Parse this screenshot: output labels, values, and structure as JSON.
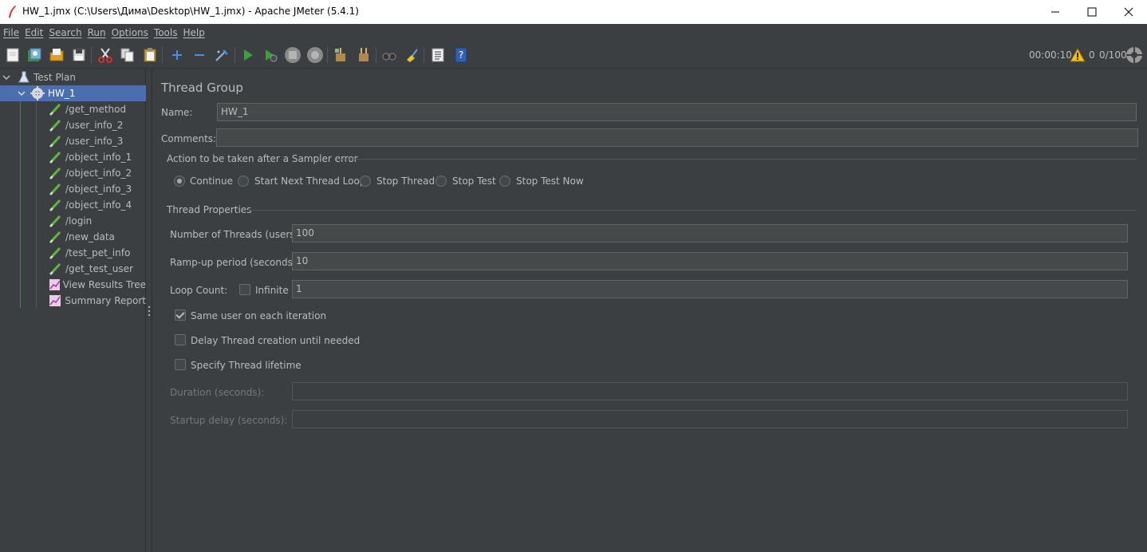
{
  "window": {
    "title": "HW_1.jmx (C:\\Users\\Дима\\Desktop\\HW_1.jmx) - Apache JMeter (5.4.1)"
  },
  "menu": [
    "File",
    "Edit",
    "Search",
    "Run",
    "Options",
    "Tools",
    "Help"
  ],
  "toolbar": {
    "timer": "00:00:10",
    "warnings": "0",
    "threads": "0/100"
  },
  "tree": {
    "root": "Test Plan",
    "group": "HW_1",
    "children": [
      "/get_method",
      "/user_info_2",
      "/user_info_3",
      "/object_info_1",
      "/object_info_2",
      "/object_info_3",
      "/object_info_4",
      "/login",
      "/new_data",
      "/test_pet_info",
      "/get_test_user",
      "View Results Tree",
      "Summary Report"
    ]
  },
  "panel": {
    "title": "Thread Group",
    "name_label": "Name:",
    "name_value": "HW_1",
    "comments_label": "Comments:",
    "comments_value": "",
    "action_group_title": "Action to be taken after a Sampler error",
    "actions": [
      "Continue",
      "Start Next Thread Loop",
      "Stop Thread",
      "Stop Test",
      "Stop Test Now"
    ],
    "selected_action": "Continue",
    "props_title": "Thread Properties",
    "threads_label": "Number of Threads (users):",
    "threads_value": "100",
    "rampup_label": "Ramp-up period (seconds):",
    "rampup_value": "10",
    "loop_label": "Loop Count:",
    "infinite_label": "Infinite",
    "infinite_checked": false,
    "loop_value": "1",
    "same_user_label": "Same user on each iteration",
    "same_user_checked": true,
    "delay_label": "Delay Thread creation until needed",
    "delay_checked": false,
    "lifetime_label": "Specify Thread lifetime",
    "lifetime_checked": false,
    "duration_label": "Duration (seconds):",
    "duration_value": "",
    "startup_label": "Startup delay (seconds):",
    "startup_value": ""
  },
  "colors": {
    "background": "#3c3f41",
    "selection": "#4b6eaf",
    "field": "#45494a",
    "run_green": "#3c9e3c"
  }
}
